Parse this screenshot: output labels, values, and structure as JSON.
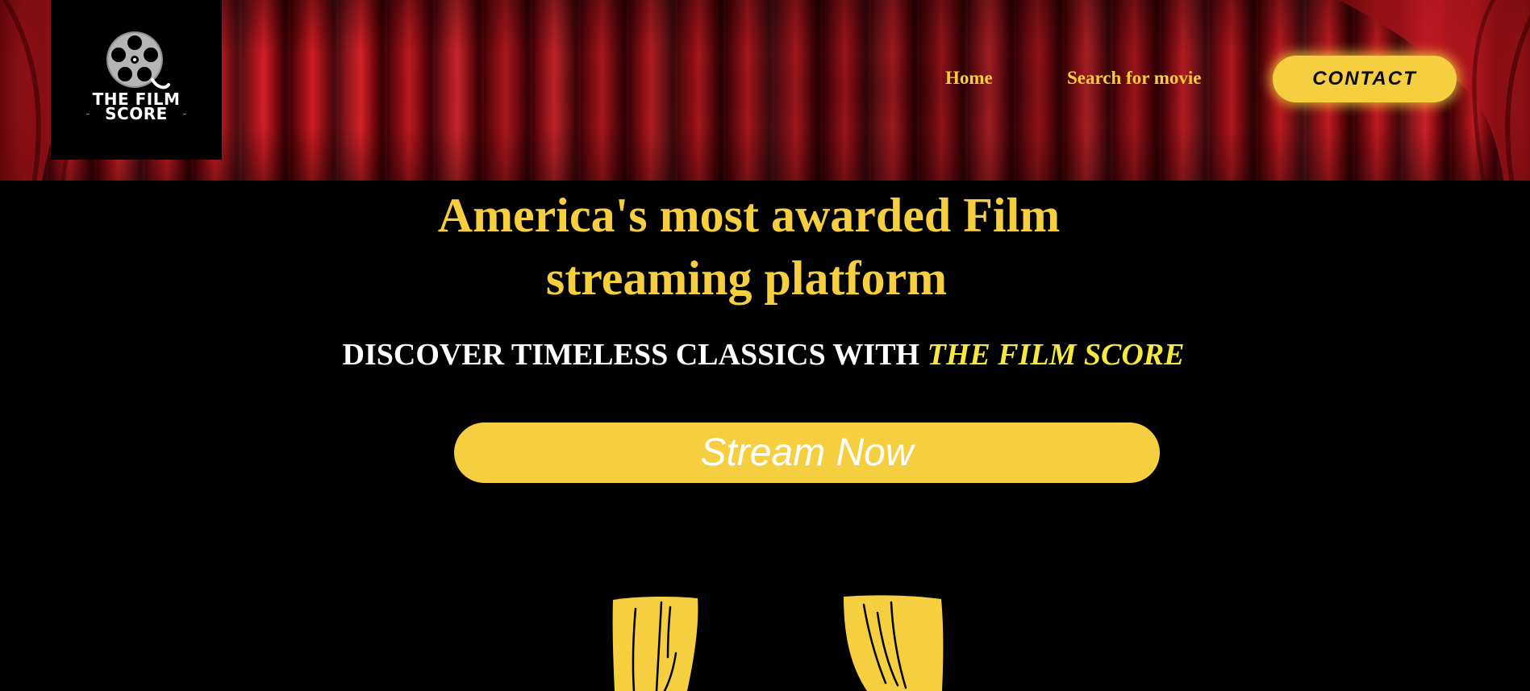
{
  "brand": {
    "logo_line1": "THE FILM",
    "logo_line2": "SCORE"
  },
  "nav": {
    "home": "Home",
    "search": "Search for movie",
    "contact": "CONTACT"
  },
  "hero": {
    "title_line1": "America's most awarded Film",
    "title_line2": "streaming platform",
    "subtitle_plain": "DISCOVER TIMELESS CLASSICS WITH ",
    "subtitle_brand": "THE FILM SCORE",
    "cta": "Stream Now"
  },
  "colors": {
    "accent_yellow": "#f5cf40",
    "brand_yellow": "#f5e840",
    "curtain_red": "#b3141b",
    "background": "#000000"
  },
  "icons": {
    "logo": "film-reel-icon",
    "decor_left": "curtain-left-icon",
    "decor_right": "curtain-right-icon"
  }
}
